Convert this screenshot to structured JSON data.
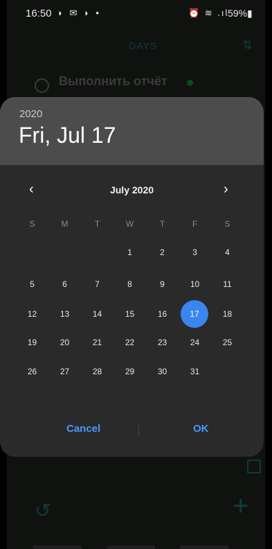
{
  "status": {
    "time": "16:50",
    "left_icons": "◗ ✉ ◗ •",
    "right_icons": "⏰ ≋ .ıl",
    "battery": "59%▮"
  },
  "header": {
    "title": "DAYS"
  },
  "task": {
    "title": "Выполнить отчёт"
  },
  "dialog": {
    "year": "2020",
    "date": "Fri, Jul 17",
    "month_label": "July 2020",
    "prev": "‹",
    "next": "›",
    "weekdays": [
      "S",
      "M",
      "T",
      "W",
      "T",
      "F",
      "S"
    ],
    "weeks": [
      [
        "",
        "",
        "",
        "1",
        "2",
        "3",
        "4"
      ],
      [
        "5",
        "6",
        "7",
        "8",
        "9",
        "10",
        "11"
      ],
      [
        "12",
        "13",
        "14",
        "15",
        "16",
        "17",
        "18"
      ],
      [
        "19",
        "20",
        "21",
        "22",
        "23",
        "24",
        "25"
      ],
      [
        "26",
        "27",
        "28",
        "29",
        "30",
        "31",
        ""
      ]
    ],
    "selected_day": "17",
    "cancel": "Cancel",
    "ok": "OK"
  },
  "colors": {
    "accent": "#3a86f0",
    "button_text": "#4a98ff"
  }
}
